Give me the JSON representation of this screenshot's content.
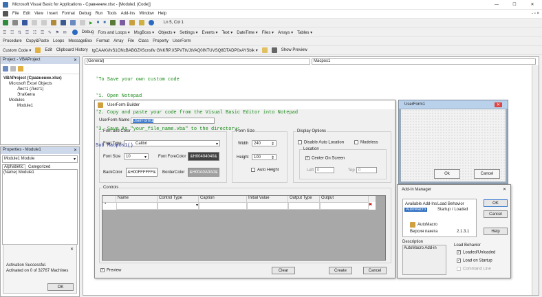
{
  "window": {
    "title": "Microsoft Visual Basic for Applications - Сравнение.xlsx - [Module1 (Code)]",
    "min": "—",
    "max": "☐",
    "close": "✕"
  },
  "menu": [
    "File",
    "Edit",
    "View",
    "Insert",
    "Format",
    "Debug",
    "Run",
    "Tools",
    "Add-Ins",
    "Window",
    "Help"
  ],
  "toolbar1": {
    "position": "Ln 5, Col 1"
  },
  "toolbar2": {
    "debug": "Debug",
    "items": [
      "Fors and Loops ▾",
      "MsgBoxs ▾",
      "Objects ▾",
      "Settings ▾",
      "Events ▾",
      "Text ▾",
      "DateTime ▾",
      "Files ▾",
      "Arrays ▾",
      "Tables ▾"
    ]
  },
  "toolbar3": [
    "Procedure",
    "Copy&Paste",
    "Loops",
    "MessageBox",
    "Format",
    "Array",
    "File",
    "Class",
    "Property",
    "UserForm"
  ],
  "toolbar4": {
    "custom_code": "Custom Code ▾",
    "edit": "Edit",
    "clipboard": "Clipboard History",
    "clip_value": "tgCAAKVlvS1ONcBABGZ#Scnsflv GNKRP.X5PVTtVJtVAQ0INTUVSQ8DTADP0xAYSbik ▾",
    "show_preview": "Show Preview"
  },
  "project": {
    "title": "Project - VBAProject",
    "tree": [
      "VBAProject (Сравнение.xlsx)",
      "Microsoft Excel Objects",
      "Лист1 (Лист1)",
      "ЭтаКнига",
      "Modules",
      "Module1"
    ]
  },
  "properties": {
    "title": "Properties - Module1",
    "object": "Module1 Module",
    "tabs": [
      "Alphabetic",
      "Categorized"
    ],
    "row_name": "(Name)",
    "row_value": "Module1"
  },
  "activation": {
    "line1": "Activation Successful.",
    "line2": "Activated on 0 of 32767 Machines",
    "ok": "OK"
  },
  "code": {
    "object": "(General)",
    "proc": "Macpos1",
    "lines": [
      "'To Save your own custom code",
      "'1. Open Notepad",
      "'2. Copy and paste your code from the Visual Basic Editor into Notepad",
      "'3. Save As \"your_file_name.vba\" to the directory:",
      "Sub Macpos1()"
    ]
  },
  "builder": {
    "title": "UserForm Builder",
    "name_label": "UserForm Name",
    "name_value": "UserForm1",
    "font_group": "Font and Color",
    "font_type": "Font Type",
    "font_value": "Calibri",
    "font_size": "Font Size",
    "size_value": "10",
    "fore": "Font ForeColor",
    "fore_value": "&H00404040&",
    "back": "BackColor",
    "back_value": "&H00FFFFFF&",
    "border": "BorderColor",
    "border_value": "&H00A0A0A0&",
    "size_group": "Form Size",
    "width": "Width",
    "width_value": "240",
    "height": "Height",
    "height_value": "100",
    "auto_height": "Auto Height",
    "display_group": "Display Options",
    "disable_auto": "Disable Auto Location",
    "modeless": "Modeless",
    "location": "Location",
    "center": "Center On Screen",
    "left": "Left",
    "left_value": "0",
    "top": "Top",
    "top_value": "0",
    "controls": "Controls",
    "columns": [
      "Name",
      "Control Type",
      "Caption",
      "Initial Value",
      "Output Type",
      "Output"
    ],
    "preview": "Preview",
    "clear": "Clear",
    "create": "Create",
    "cancel": "Cancel"
  },
  "userform": {
    "title": "UserForm1",
    "ok": "Ok",
    "cancel": "Cancel"
  },
  "addin": {
    "title": "Add-In Manager",
    "col1": "Available Add-Ins",
    "col2": "Load Behavior",
    "item": "AutoMacro",
    "item_behavior": "Startup / Loaded",
    "logo": "AutoMacro",
    "version_label": "Версия пакета",
    "version": "2.1.3.1",
    "ok": "OK",
    "cancel": "Cancel",
    "help": "Help",
    "desc_label": "Description",
    "desc": "AutoMacro Add-in",
    "lb_label": "Load Behavior",
    "loaded": "Loaded/Unloaded",
    "startup": "Load on Startup",
    "cmdline": "Command Line"
  }
}
